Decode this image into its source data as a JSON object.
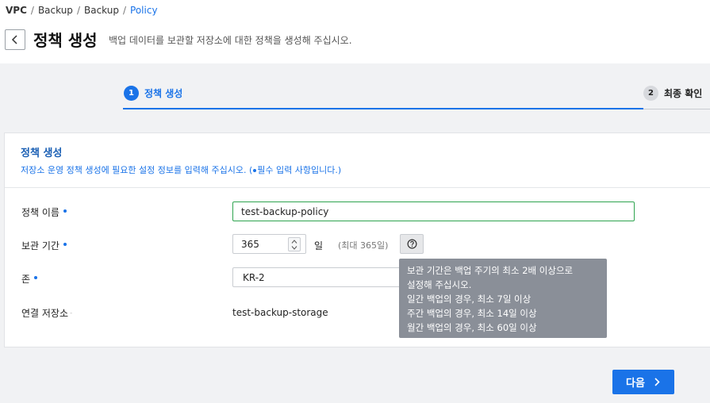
{
  "breadcrumb": [
    "VPC",
    "Backup",
    "Backup",
    "Policy"
  ],
  "header": {
    "title": "정책 생성",
    "description": "백업 데이터를 보관할 저장소에 대한 정책을 생성해 주십시오."
  },
  "steps": [
    {
      "number": "1",
      "label": "정책 생성"
    },
    {
      "number": "2",
      "label": "최종 확인"
    }
  ],
  "form": {
    "title": "정책 생성",
    "description_before": "저장소 운영 정책 생성에 필요한 설정 정보를 입력해 주십시오. (",
    "description_after": "필수 입력 사항입니다.)",
    "fields": {
      "policy_name": {
        "label": "정책 이름",
        "value": "test-backup-policy"
      },
      "retention": {
        "label": "보관 기간",
        "value": "365",
        "unit": "일",
        "max_note": "(최대 365일)"
      },
      "zone": {
        "label": "존",
        "value": "KR-2"
      },
      "linked_storage": {
        "label": "연결 저장소",
        "value": "test-backup-storage"
      }
    }
  },
  "tooltip": {
    "lines": [
      "보관 기간은 백업 주기의 최소 2배 이상으로",
      "설정해 주십시오.",
      "일간 백업의 경우, 최소 7일 이상",
      "주간 백업의 경우, 최소 14일 이상",
      "월간 백업의 경우, 최소 60일 이상"
    ]
  },
  "buttons": {
    "next": "다음"
  },
  "icons": {
    "back": "chevron-left-icon",
    "help": "question-circle-icon",
    "next": "chevron-right-icon",
    "stepper_up": "caret-up-icon",
    "stepper_down": "caret-down-icon"
  },
  "colors": {
    "accent": "#1a73e8",
    "valid_border": "#2ea44f",
    "tooltip_bg": "#8a8f98"
  }
}
